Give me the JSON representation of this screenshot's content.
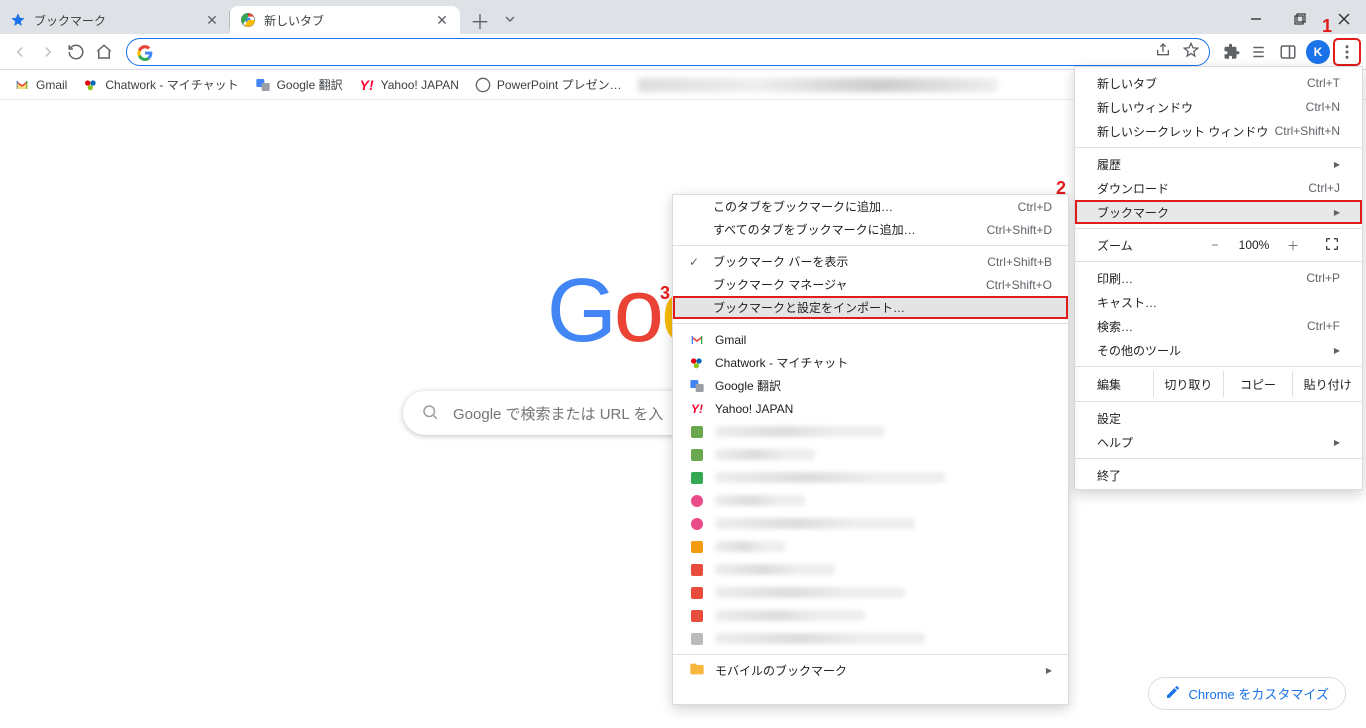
{
  "tabs": [
    {
      "title": "ブックマーク",
      "favicon": "star"
    },
    {
      "title": "新しいタブ",
      "favicon": "chrome"
    }
  ],
  "active_tab_index": 1,
  "toolbar": {
    "profile_initial": "K"
  },
  "bookmarks_bar": [
    {
      "label": "Gmail",
      "icon": "gmail"
    },
    {
      "label": "Chatwork - マイチャット",
      "icon": "chatwork"
    },
    {
      "label": "Google 翻訳",
      "icon": "gtranslate"
    },
    {
      "label": "Yahoo! JAPAN",
      "icon": "yahoo"
    },
    {
      "label": "PowerPoint プレゼン…",
      "icon": "powerpoint"
    }
  ],
  "newtab": {
    "search_placeholder": "Google で検索または URL を入",
    "customize_label": "Chrome をカスタマイズ"
  },
  "main_menu": {
    "new_tab": {
      "label": "新しいタブ",
      "shortcut": "Ctrl+T"
    },
    "new_window": {
      "label": "新しいウィンドウ",
      "shortcut": "Ctrl+N"
    },
    "new_incognito": {
      "label": "新しいシークレット ウィンドウ",
      "shortcut": "Ctrl+Shift+N"
    },
    "history": {
      "label": "履歴"
    },
    "downloads": {
      "label": "ダウンロード",
      "shortcut": "Ctrl+J"
    },
    "bookmarks": {
      "label": "ブックマーク"
    },
    "zoom_label": "ズーム",
    "zoom_value": "100%",
    "print": {
      "label": "印刷…",
      "shortcut": "Ctrl+P"
    },
    "cast": {
      "label": "キャスト…"
    },
    "find": {
      "label": "検索…",
      "shortcut": "Ctrl+F"
    },
    "more_tools": {
      "label": "その他のツール"
    },
    "edit_label": "編集",
    "edit_cut": "切り取り",
    "edit_copy": "コピー",
    "edit_paste": "貼り付け",
    "settings": {
      "label": "設定"
    },
    "help": {
      "label": "ヘルプ"
    },
    "exit": {
      "label": "終了"
    }
  },
  "bookmark_submenu": {
    "add_this": {
      "label": "このタブをブックマークに追加…",
      "shortcut": "Ctrl+D"
    },
    "add_all": {
      "label": "すべてのタブをブックマークに追加…",
      "shortcut": "Ctrl+Shift+D"
    },
    "show_bar": {
      "label": "ブックマーク バーを表示",
      "shortcut": "Ctrl+Shift+B",
      "checked": true
    },
    "manager": {
      "label": "ブックマーク マネージャ",
      "shortcut": "Ctrl+Shift+O"
    },
    "import": {
      "label": "ブックマークと設定をインポート…"
    },
    "items": [
      {
        "label": "Gmail",
        "icon": "gmail"
      },
      {
        "label": "Chatwork - マイチャット",
        "icon": "chatwork"
      },
      {
        "label": "Google 翻訳",
        "icon": "gtranslate"
      },
      {
        "label": "Yahoo! JAPAN",
        "icon": "yahoo"
      }
    ],
    "mobile_folder": "モバイルのブックマーク"
  },
  "annotations": {
    "one": "1",
    "two": "2",
    "three": "3"
  }
}
